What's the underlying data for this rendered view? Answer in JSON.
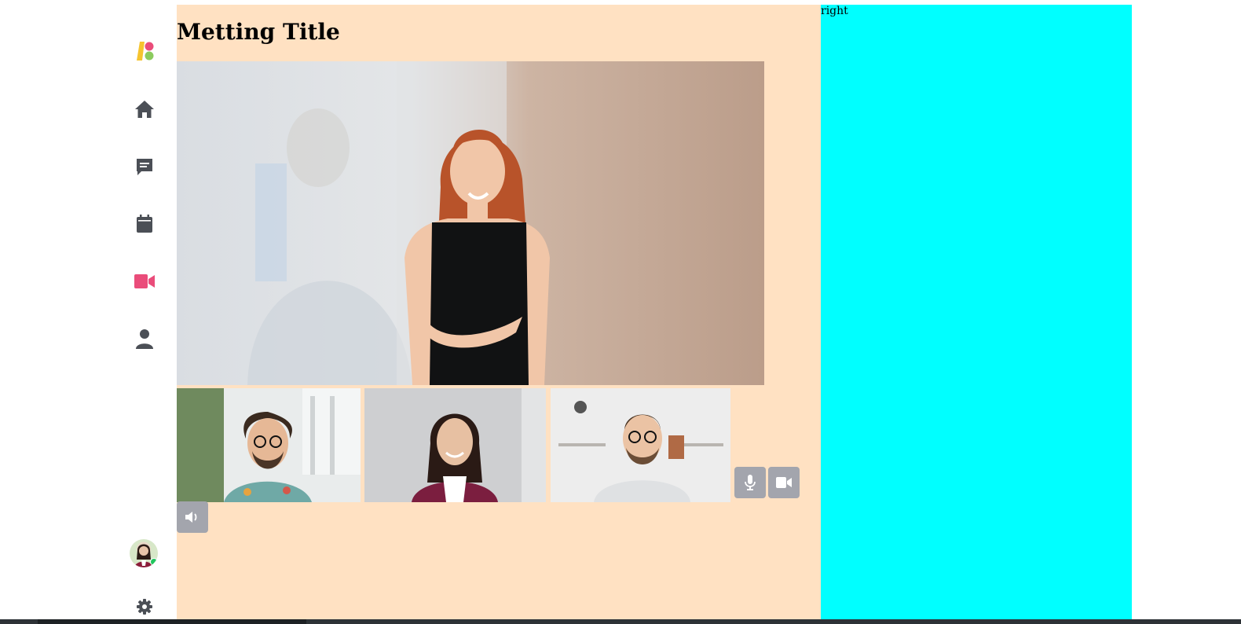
{
  "meeting": {
    "title": "Metting Title"
  },
  "right_panel": {
    "label": "right"
  },
  "sidebar": {
    "items": [
      {
        "icon": "logo-icon"
      },
      {
        "icon": "home-icon"
      },
      {
        "icon": "chat-icon"
      },
      {
        "icon": "calendar-icon"
      },
      {
        "icon": "video-icon",
        "active": true
      },
      {
        "icon": "user-icon"
      }
    ],
    "footer": [
      {
        "icon": "avatar",
        "status": "online"
      },
      {
        "icon": "gear-icon"
      }
    ]
  },
  "controls": [
    {
      "icon": "mic-icon"
    },
    {
      "icon": "camera-icon"
    },
    {
      "icon": "speaker-icon"
    }
  ],
  "colors": {
    "sidebar_icon": "#4b4f56",
    "active_icon": "#ea4c7a",
    "logo_yellow": "#f6c42f",
    "logo_pink": "#ea4c7a",
    "logo_green": "#8ccb5e",
    "main_bg": "#ffe1c2",
    "right_bg": "#00ffff",
    "control_bg": "#a3a5ad",
    "online": "#22c55e"
  }
}
